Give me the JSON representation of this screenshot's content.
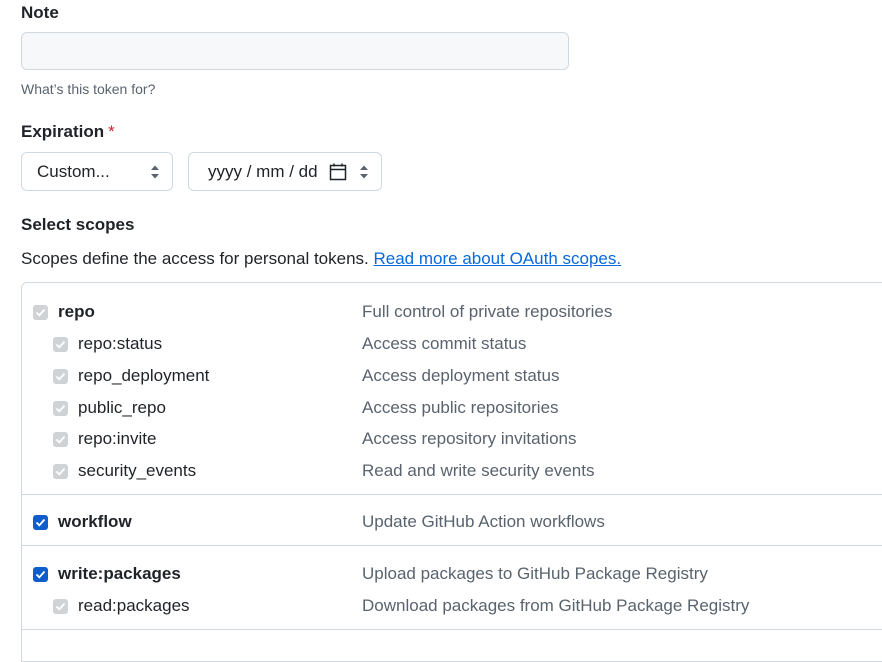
{
  "note": {
    "label": "Note",
    "value": "",
    "placeholder": "",
    "help": "What’s this token for?"
  },
  "expiration": {
    "label": "Expiration",
    "required_mark": "*",
    "selected": "Custom...",
    "date_placeholder": "yyyy / mm / dd"
  },
  "scopes": {
    "title": "Select scopes",
    "description": "Scopes define the access for personal tokens.",
    "link": "Read more about OAuth scopes.",
    "groups": [
      {
        "name": "repo",
        "desc": "Full control of private repositories",
        "checked": true,
        "disabled": true,
        "children": [
          {
            "name": "repo:status",
            "desc": "Access commit status"
          },
          {
            "name": "repo_deployment",
            "desc": "Access deployment status"
          },
          {
            "name": "public_repo",
            "desc": "Access public repositories"
          },
          {
            "name": "repo:invite",
            "desc": "Access repository invitations"
          },
          {
            "name": "security_events",
            "desc": "Read and write security events"
          }
        ]
      },
      {
        "name": "workflow",
        "desc": "Update GitHub Action workflows",
        "checked": true,
        "disabled": false,
        "children": []
      },
      {
        "name": "write:packages",
        "desc": "Upload packages to GitHub Package Registry",
        "checked": true,
        "disabled": false,
        "children": [
          {
            "name": "read:packages",
            "desc": "Download packages from GitHub Package Registry"
          }
        ]
      }
    ]
  },
  "colors": {
    "accent": "#0969da",
    "checkbox_checked": "#0f5dc9",
    "checkbox_disabled": "#d0d3d6",
    "required": "#d1242f"
  }
}
